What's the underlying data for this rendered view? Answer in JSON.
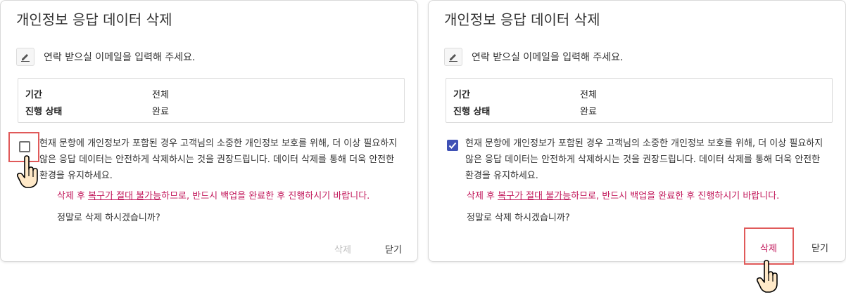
{
  "dialogs": [
    {
      "title": "개인정보 응답 데이터 삭제",
      "email_prompt": "연락 받으실 이메일을 입력해 주세요.",
      "info": [
        {
          "label": "기간",
          "value": "전체"
        },
        {
          "label": "진행 상태",
          "value": "완료"
        }
      ],
      "checkbox_checked": false,
      "notice": "현재 문항에 개인정보가 포함된 경우 고객님의 소중한 개인정보 보호를 위해, 더 이상 필요하지 않은 응답 데이터는 안전하게 삭제하시는 것을 권장드립니다. 데이터 삭제를 통해 더욱 안전한 환경을 유지하세요.",
      "warning_pre": "삭제 후 ",
      "warning_emph": "복구가 절대 불가능",
      "warning_post": "하므로, 반드시 백업을 완료한 후 진행하시기 바랍니다.",
      "confirm": "정말로 삭제 하시겠습니까?",
      "delete_label": "삭제",
      "close_label": "닫기"
    },
    {
      "title": "개인정보 응답 데이터 삭제",
      "email_prompt": "연락 받으실 이메일을 입력해 주세요.",
      "info": [
        {
          "label": "기간",
          "value": "전체"
        },
        {
          "label": "진행 상태",
          "value": "완료"
        }
      ],
      "checkbox_checked": true,
      "notice": "현재 문항에 개인정보가 포함된 경우 고객님의 소중한 개인정보 보호를 위해, 더 이상 필요하지 않은 응답 데이터는 안전하게 삭제하시는 것을 권장드립니다. 데이터 삭제를 통해 더욱 안전한 환경을 유지하세요.",
      "warning_pre": "삭제 후 ",
      "warning_emph": "복구가 절대 불가능",
      "warning_post": "하므로, 반드시 백업을 완료한 후 진행하시기 바랍니다.",
      "confirm": "정말로 삭제 하시겠습니까?",
      "delete_label": "삭제",
      "close_label": "닫기"
    }
  ],
  "colors": {
    "accent": "#3f51b5",
    "warning": "#c2185b",
    "highlight": "#e05a5a",
    "disabled": "#bdbdbd"
  },
  "icons": {
    "edit": "pencil-icon",
    "pointer": "hand-pointer-icon",
    "check": "check-icon"
  }
}
